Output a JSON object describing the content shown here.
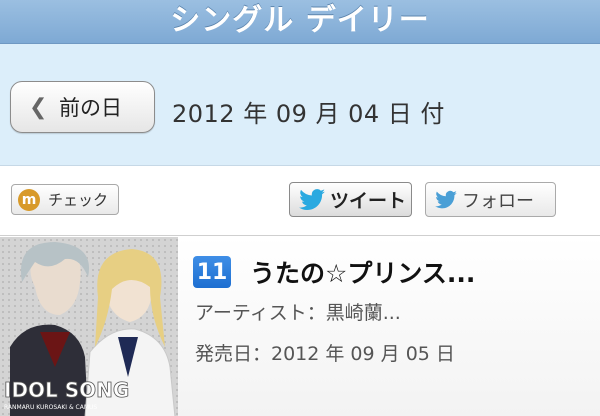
{
  "header": {
    "title": "シングル デイリー"
  },
  "datebar": {
    "back_label": "前の日",
    "date_text": "2012 年 09 月 04 日 付"
  },
  "social": {
    "check_label": "チェック",
    "tweet_label": "ツイート",
    "follow_label": "フォロー",
    "mixi_letter": "m"
  },
  "item": {
    "rank": "11",
    "title": "うたの☆プリンス...",
    "artist": "アーティスト：黒崎蘭...",
    "release": "発売日：2012 年 09 月 05 日",
    "cover_text_main": "IDOL SONG",
    "cover_text_sub": "RANMARU KUROSAKI & CAMUS"
  },
  "colors": {
    "header": "#8bb4dc",
    "datebar": "#dceefa",
    "rank_badge": "#1d6fd1",
    "twitter": "#2aa9e0"
  },
  "icons": {
    "back": "chevron-left-icon",
    "check": "mixi-icon",
    "tweet": "twitter-bird-icon",
    "follow": "twitter-bird-icon"
  }
}
